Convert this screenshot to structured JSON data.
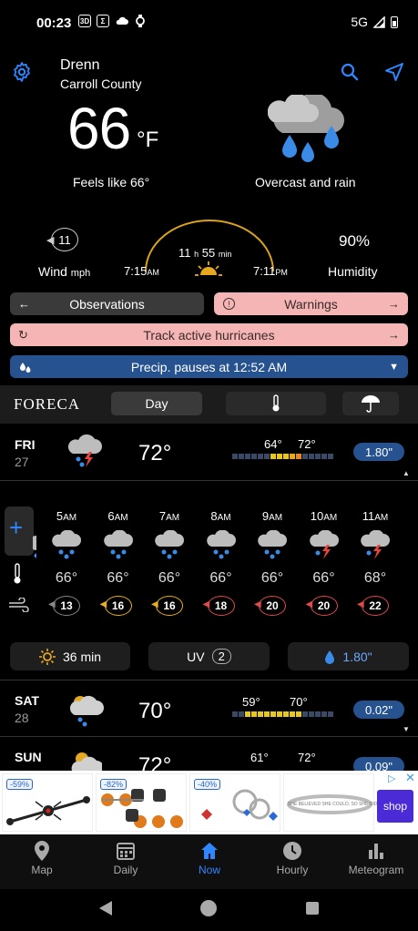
{
  "status_bar": {
    "time": "00:23",
    "left_icons": [
      "3D",
      "Σ"
    ],
    "network": "5G"
  },
  "location": {
    "name": "Drenn",
    "county": "Carroll County"
  },
  "current": {
    "temp": "66",
    "unit": "°F",
    "feels_like": "Feels like 66°",
    "condition": "Overcast and rain"
  },
  "wind": {
    "speed": "11",
    "label": "Wind",
    "unit": "mph"
  },
  "sun": {
    "day_length_h": "11",
    "h": "h",
    "day_length_m": "55",
    "min": "min",
    "sunrise": "7:15",
    "sunrise_ampm": "AM",
    "sunset": "7:11",
    "sunset_ampm": "PM"
  },
  "humidity": {
    "value": "90%",
    "label": "Humidity"
  },
  "buttons": {
    "observations": "Observations",
    "warnings": "Warnings",
    "hurricanes": "Track active hurricanes",
    "precip": "Precip. pauses at 12:52 AM"
  },
  "toolbar": {
    "logo": "FORECA",
    "day_tab": "Day"
  },
  "days": [
    {
      "name": "FRI",
      "date": "27",
      "temp": "72°",
      "low": "64°",
      "high": "72°",
      "precip": "1.80\""
    },
    {
      "name": "SAT",
      "date": "28",
      "temp": "70°",
      "low": "59°",
      "high": "70°",
      "precip": "0.02\""
    },
    {
      "name": "SUN",
      "date": "",
      "temp": "72°",
      "low": "61°",
      "high": "72°",
      "precip": "0.09\""
    }
  ],
  "hourly": [
    {
      "hour": "5",
      "ampm": "AM",
      "temp": "66°",
      "wind": "13",
      "wind_color": "#888888",
      "icon": "rain"
    },
    {
      "hour": "6",
      "ampm": "AM",
      "temp": "66°",
      "wind": "16",
      "wind_color": "#e6b020",
      "icon": "rain"
    },
    {
      "hour": "7",
      "ampm": "AM",
      "temp": "66°",
      "wind": "16",
      "wind_color": "#e6b020",
      "icon": "rain"
    },
    {
      "hour": "8",
      "ampm": "AM",
      "temp": "66°",
      "wind": "18",
      "wind_color": "#e04a4a",
      "icon": "rain"
    },
    {
      "hour": "9",
      "ampm": "AM",
      "temp": "66°",
      "wind": "20",
      "wind_color": "#e04a4a",
      "icon": "rain"
    },
    {
      "hour": "10",
      "ampm": "AM",
      "temp": "66°",
      "wind": "20",
      "wind_color": "#e04a4a",
      "icon": "storm"
    },
    {
      "hour": "11",
      "ampm": "AM",
      "temp": "68°",
      "wind": "22",
      "wind_color": "#e04a4a",
      "icon": "storm"
    }
  ],
  "hourly_partial": {
    "temp": "°"
  },
  "info_chips": {
    "sunshine": "36 min",
    "uv_label": "UV",
    "uv_value": "2",
    "precip": "1.80\""
  },
  "ad": {
    "discounts": [
      "-59%",
      "-82%",
      "-40%"
    ],
    "shop_label": "shop",
    "bracelet_text": "SHE BELIEVED SHE COULD, SO SHE DID"
  },
  "nav": [
    {
      "label": "Map",
      "icon": "map-pin-icon"
    },
    {
      "label": "Daily",
      "icon": "calendar-icon"
    },
    {
      "label": "Now",
      "icon": "home-icon",
      "active": true
    },
    {
      "label": "Hourly",
      "icon": "clock-icon"
    },
    {
      "label": "Meteogram",
      "icon": "bar-chart-icon"
    }
  ],
  "colors": {
    "accent": "#2f86ff",
    "warning_bg": "#f5b5b5",
    "precip_blue": "#26528f"
  }
}
